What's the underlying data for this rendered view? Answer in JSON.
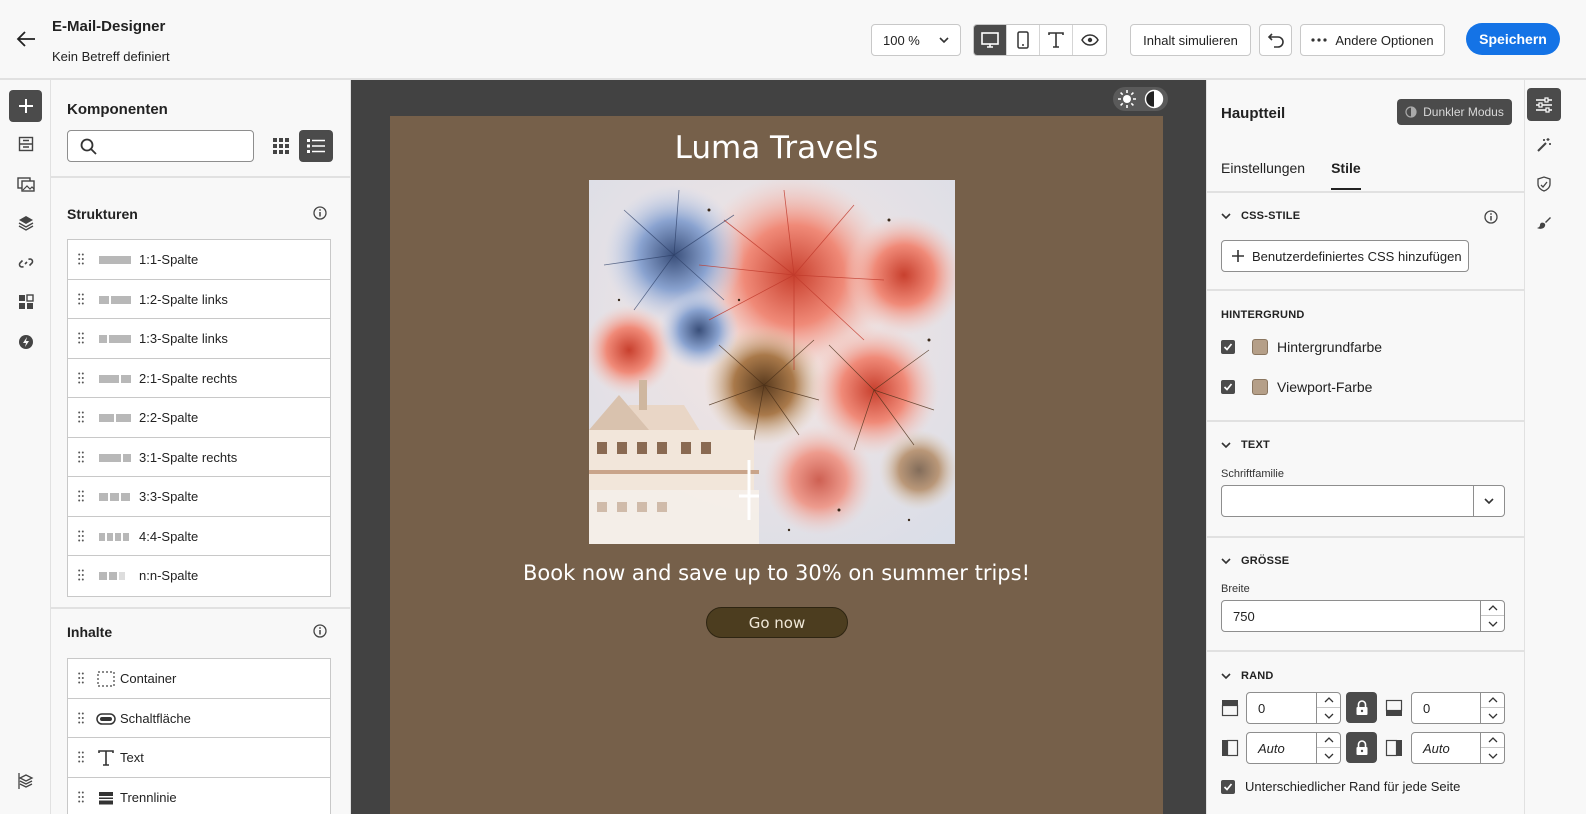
{
  "header": {
    "title": "E-Mail-Designer",
    "subtitle": "Kein Betreff definiert",
    "zoom": "100 %",
    "simulate_label": "Inhalt simulieren",
    "more_options_label": "Andere Optionen",
    "save_label": "Speichern"
  },
  "components": {
    "title": "Komponenten",
    "search_placeholder": "",
    "structures_title": "Strukturen",
    "structures": [
      {
        "label": "1:1-Spalte"
      },
      {
        "label": "1:2-Spalte links"
      },
      {
        "label": "1:3-Spalte links"
      },
      {
        "label": "2:1-Spalte rechts"
      },
      {
        "label": "2:2-Spalte"
      },
      {
        "label": "3:1-Spalte rechts"
      },
      {
        "label": "3:3-Spalte"
      },
      {
        "label": "4:4-Spalte"
      },
      {
        "label": "n:n-Spalte"
      }
    ],
    "contents_title": "Inhalte",
    "contents": [
      {
        "label": "Container",
        "icon": "container-icon"
      },
      {
        "label": "Schaltfläche",
        "icon": "button-shape-icon"
      },
      {
        "label": "Text",
        "icon": "text-icon"
      },
      {
        "label": "Trennlinie",
        "icon": "divider-icon"
      }
    ]
  },
  "email": {
    "title": "Luma Travels",
    "body_text": "Book now and save up to 30% on summer trips!",
    "button_label": "Go now",
    "background_color": "#76604a",
    "button_color": "#4c3d1f"
  },
  "properties": {
    "title": "Hauptteil",
    "dark_mode_label": "Dunkler Modus",
    "tabs": [
      {
        "label": "Einstellungen"
      },
      {
        "label": "Stile"
      }
    ],
    "css_section": "CSS-STILE",
    "css_button": "Benutzerdefiniertes CSS hinzufügen",
    "background_section": "HINTERGRUND",
    "background_color_label": "Hintergrundfarbe",
    "viewport_color_label": "Viewport-Farbe",
    "text_section": "TEXT",
    "font_family_label": "Schriftfamilie",
    "font_family_value": "",
    "size_section": "GRÖSSE",
    "width_label": "Breite",
    "width_value": "750",
    "border_section": "RAND",
    "margin_top": "0",
    "margin_bottom": "0",
    "margin_left": "Auto",
    "margin_right": "Auto",
    "different_margin_label": "Unterschiedlicher Rand für jede Seite"
  }
}
